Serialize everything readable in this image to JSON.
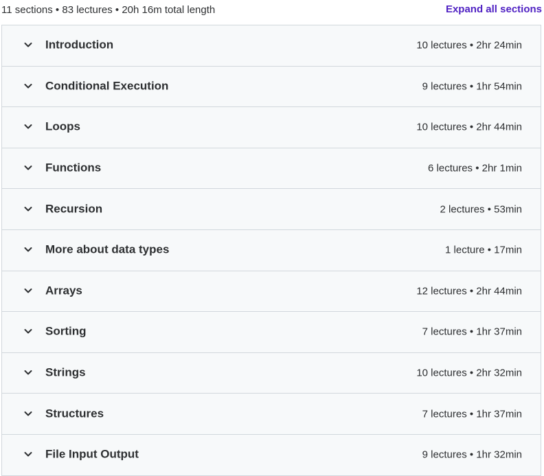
{
  "summary": {
    "text": "11 sections • 83 lectures • 20h 16m total length",
    "expand_label": "Expand all sections"
  },
  "colors": {
    "accent": "#5022c3",
    "row_background": "#f7f9fa",
    "border": "#d1d7dc",
    "text": "#2d2f31"
  },
  "icons": {
    "section_toggle": "chevron-down-icon"
  },
  "sections": [
    {
      "title": "Introduction",
      "meta": "10 lectures • 2hr 24min"
    },
    {
      "title": "Conditional Execution",
      "meta": "9 lectures • 1hr 54min"
    },
    {
      "title": "Loops",
      "meta": "10 lectures • 2hr 44min"
    },
    {
      "title": "Functions",
      "meta": "6 lectures • 2hr 1min"
    },
    {
      "title": "Recursion",
      "meta": "2 lectures • 53min"
    },
    {
      "title": "More about data types",
      "meta": "1 lecture • 17min"
    },
    {
      "title": "Arrays",
      "meta": "12 lectures • 2hr 44min"
    },
    {
      "title": "Sorting",
      "meta": "7 lectures • 1hr 37min"
    },
    {
      "title": "Strings",
      "meta": "10 lectures • 2hr 32min"
    },
    {
      "title": "Structures",
      "meta": "7 lectures • 1hr 37min"
    },
    {
      "title": "File Input Output",
      "meta": "9 lectures • 1hr 32min"
    }
  ]
}
